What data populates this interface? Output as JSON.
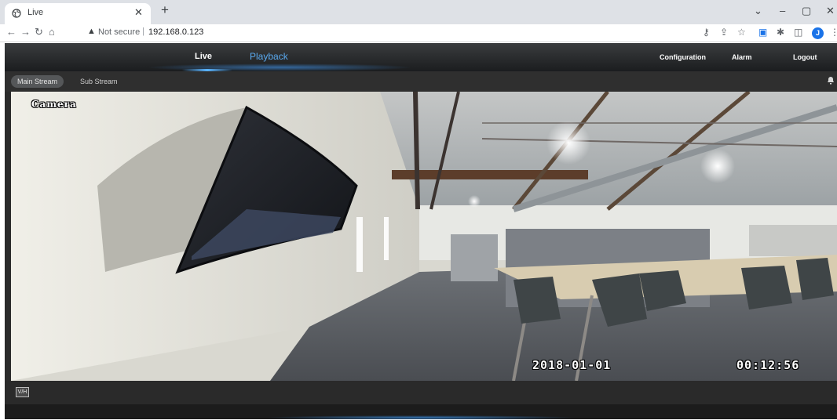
{
  "browser": {
    "tab_title": "Live",
    "url_warning": "Not secure",
    "url_separator": "|",
    "url": "192.168.0.123",
    "profile_initial": "J"
  },
  "app": {
    "nav": {
      "live": "Live",
      "playback": "Playback",
      "configuration": "Configuration",
      "alarm": "Alarm",
      "logout": "Logout"
    },
    "streams": {
      "main": "Main Stream",
      "sub": "Sub Stream"
    },
    "osd": {
      "camera_name": "Camera",
      "date": "2018-01-01",
      "time": "00:12:56"
    },
    "vh_button": "V/H"
  },
  "colors": {
    "accent": "#5aaaf0",
    "nav_bg": "#1b1d1f",
    "browser_frame": "#dee1e6"
  }
}
